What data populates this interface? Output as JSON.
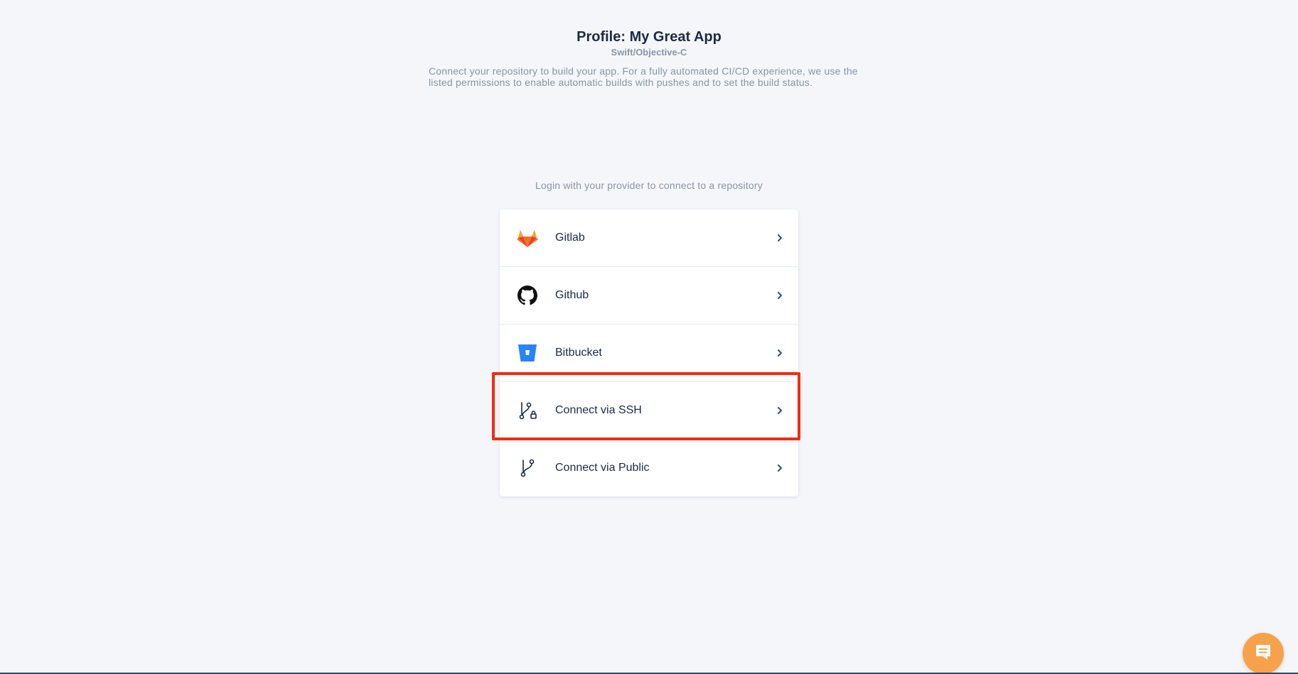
{
  "header": {
    "title": "Profile: My Great App",
    "subtitle": "Swift/Objective-C",
    "description": "Connect your repository to build your app. For a fully automated CI/CD experience, we use the listed permissions to enable automatic builds with pushes and to set the build status."
  },
  "login_hint": "Login with your provider to connect to a repository",
  "providers": [
    {
      "label": "Gitlab",
      "icon": "gitlab-icon"
    },
    {
      "label": "Github",
      "icon": "github-icon"
    },
    {
      "label": "Bitbucket",
      "icon": "bitbucket-icon"
    },
    {
      "label": "Connect via SSH",
      "icon": "git-branch-lock-icon"
    },
    {
      "label": "Connect via Public",
      "icon": "git-branch-icon"
    }
  ],
  "highlight": {
    "target": "Connect via SSH",
    "color": "#f42a12"
  },
  "colors": {
    "background": "#f4f6fa",
    "title": "#1c2b45",
    "muted": "#8a95a5",
    "chat_button": "#f7a24a"
  },
  "chat": {
    "icon": "chat-icon"
  }
}
